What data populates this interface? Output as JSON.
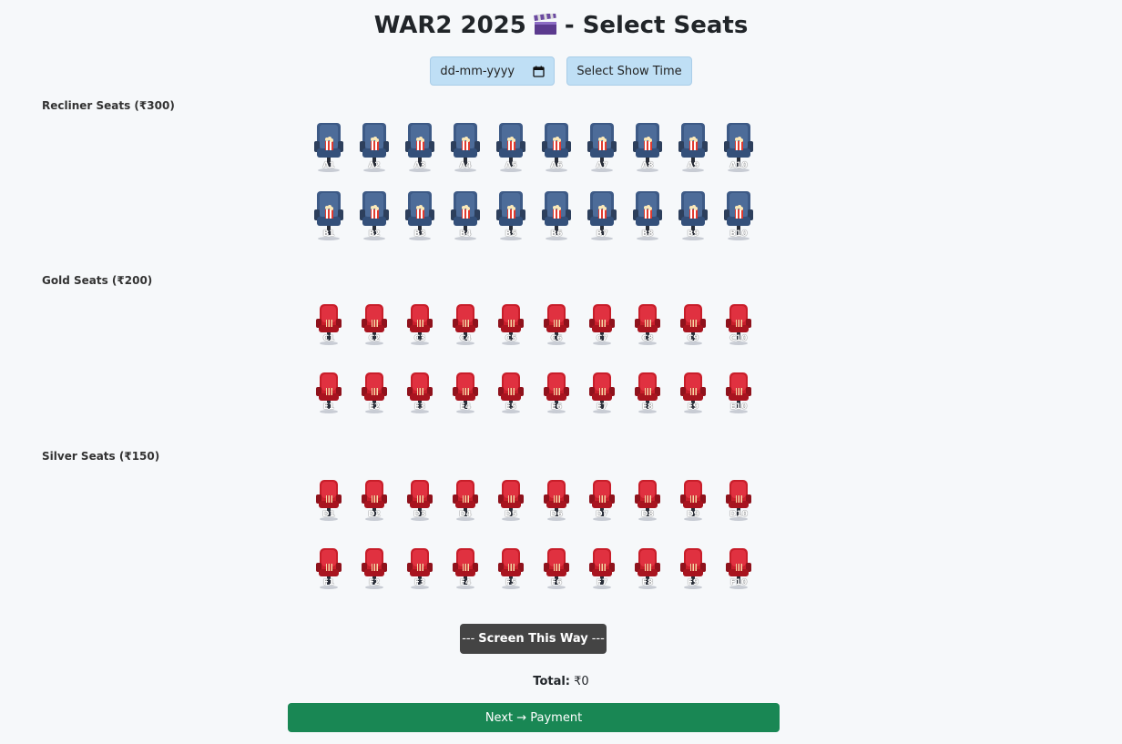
{
  "page": {
    "title_prefix": "WAR2 2025",
    "title_suffix": "- Select Seats"
  },
  "controls": {
    "date_placeholder": "dd-mm-yyyy",
    "show_time_label": "Select Show Time"
  },
  "sections": [
    {
      "label": "Recliner Seats (₹300)",
      "type": "recliner",
      "rows": [
        [
          "A1",
          "A2",
          "A3",
          "A4",
          "A5",
          "A6",
          "A7",
          "A8",
          "A9",
          "A10"
        ],
        [
          "B1",
          "B2",
          "B3",
          "B4",
          "B5",
          "B6",
          "B7",
          "B8",
          "B9",
          "B10"
        ]
      ]
    },
    {
      "label": "Gold Seats (₹200)",
      "type": "gold",
      "rows": [
        [
          "C1",
          "C2",
          "C3",
          "C4",
          "C5",
          "C6",
          "C7",
          "C8",
          "C9",
          "C10"
        ],
        [
          "E1",
          "E2",
          "E3",
          "E4",
          "E5",
          "E6",
          "E7",
          "E8",
          "E9",
          "E10"
        ]
      ]
    },
    {
      "label": "Silver Seats (₹150)",
      "type": "silver",
      "rows": [
        [
          "D1",
          "D2",
          "D3",
          "D4",
          "D5",
          "D6",
          "D7",
          "D8",
          "D9",
          "D10"
        ],
        [
          "F1",
          "F2",
          "F3",
          "F4",
          "F5",
          "F6",
          "F7",
          "F8",
          "F9",
          "F10"
        ]
      ]
    }
  ],
  "screen_label": "Screen This Way",
  "screen_dashes": "---",
  "total": {
    "label": "Total:",
    "value": "₹0"
  },
  "next_button": "Next → Payment",
  "colors": {
    "recliner": "#3d5a86",
    "standard": "#c81e2a",
    "next": "#198754",
    "screen": "#444444"
  }
}
